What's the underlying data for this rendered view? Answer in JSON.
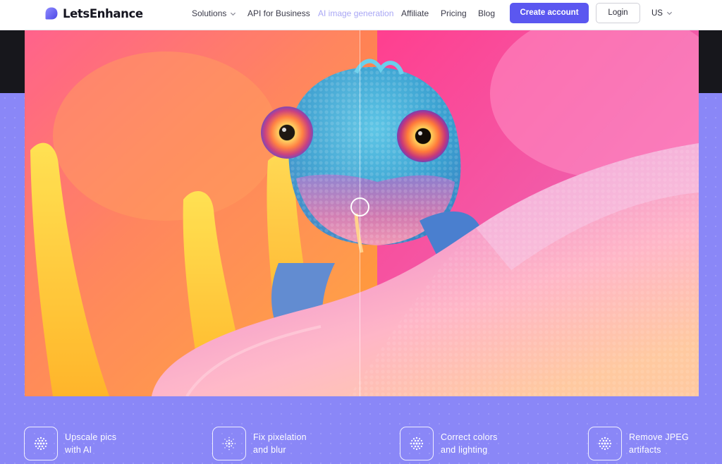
{
  "brand": {
    "name": "LetsEnhance",
    "accent": "#5b57f0",
    "hero_bg": "#8a87f7"
  },
  "nav": {
    "items": [
      {
        "label": "Solutions",
        "has_dropdown": true
      },
      {
        "label": "API for Business"
      },
      {
        "label": "AI image generation",
        "state": "faded"
      },
      {
        "label": "Affiliate"
      },
      {
        "label": "Pricing"
      },
      {
        "label": "Blog"
      }
    ],
    "create_account": "Create account",
    "login": "Login",
    "language": "US"
  },
  "compare": {
    "subject": "chameleon on flower petal",
    "split_percent": 50,
    "handle_icon": "circle-drag-handle"
  },
  "features": [
    {
      "line1": "Upscale pics",
      "line2": "with AI",
      "icon": "dot-sphere-icon"
    },
    {
      "line1": "Fix pixelation",
      "line2": "and blur",
      "icon": "dot-burst-icon"
    },
    {
      "line1": "Correct colors",
      "line2": "and lighting",
      "icon": "dot-sphere-icon"
    },
    {
      "line1": "Remove JPEG",
      "line2": "artifacts",
      "icon": "dot-sphere-icon"
    }
  ]
}
